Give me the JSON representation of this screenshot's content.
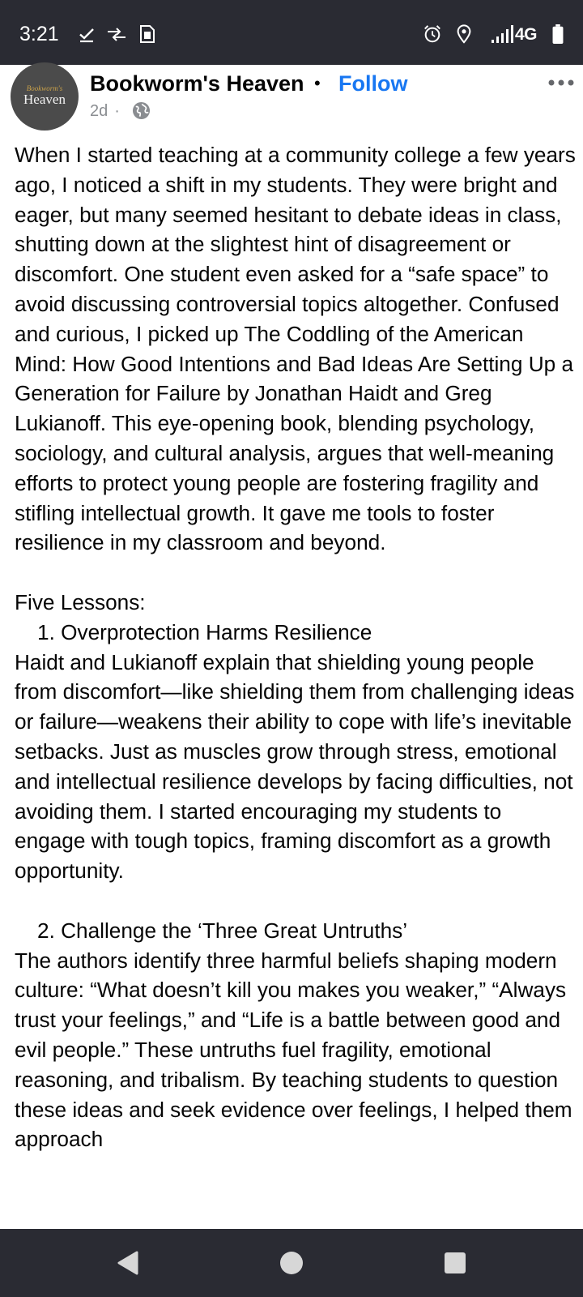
{
  "status_bar": {
    "time": "3:21",
    "network": "4G",
    "icons": [
      "check-icon",
      "swap-arrows-icon",
      "sim-card-icon",
      "alarm-icon",
      "location-pin-icon",
      "signal-icon",
      "battery-icon"
    ]
  },
  "post": {
    "page_name": "Bookworm's Heaven",
    "separator": "•",
    "follow_label": "Follow",
    "time_ago": "2d",
    "meta_dot": "·",
    "audience_icon": "globe-icon",
    "avatar_text_small": "Bookworm's",
    "avatar_text_large": "Heaven",
    "paragraphs": [
      "When I started teaching at a community college a few years ago, I noticed a shift in my students. They were bright and eager, but many seemed hesitant to debate ideas in class, shutting down at the slightest hint of disagreement or discomfort. One student even asked for a “safe space” to avoid discussing controversial topics altogether. Confused and curious, I picked up The Coddling of the American Mind: How Good Intentions and Bad Ideas Are Setting Up a Generation for Failure by Jonathan Haidt and Greg Lukianoff. This eye-opening book, blending psychology, sociology, and cultural analysis, argues that well-meaning efforts to protect young people are fostering fragility and stifling intellectual growth. It gave me tools to foster resilience in my classroom and beyond."
    ],
    "lessons_heading": "Five Lessons:",
    "lessons": [
      {
        "title": "1. Overprotection Harms Resilience",
        "text": "Haidt and Lukianoff explain that shielding young people from discomfort—like shielding them from challenging ideas or failure—weakens their ability to cope with life’s inevitable setbacks. Just as muscles grow through stress, emotional and intellectual resilience develops by facing difficulties, not avoiding them. I started encouraging my students to engage with tough topics, framing discomfort as a growth opportunity."
      },
      {
        "title": "2. Challenge the ‘Three Great Untruths’",
        "text": "The authors identify three harmful beliefs shaping modern culture: “What doesn’t kill you makes you weaker,” “Always trust your feelings,” and “Life is a battle between good and evil people.” These untruths fuel fragility, emotional reasoning, and tribalism. By teaching students to question these ideas and seek evidence over feelings, I helped them approach"
      }
    ]
  },
  "nav_bar": {
    "buttons": [
      "back",
      "home",
      "recents"
    ]
  }
}
